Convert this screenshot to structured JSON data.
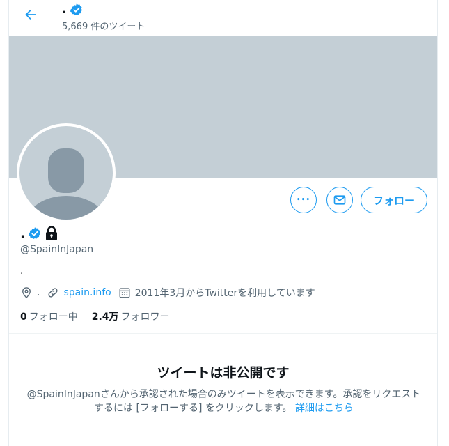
{
  "header": {
    "name": ".",
    "tweet_count": "5,669 件のツイート"
  },
  "profile": {
    "name": ".",
    "handle": "@SpainInJapan",
    "bio": ".",
    "location": ".",
    "website": "spain.info",
    "joined": "2011年3月からTwitterを利用しています",
    "following_count": "0",
    "following_label": "フォロー中",
    "followers_count": "2.4万",
    "followers_label": "フォロワー"
  },
  "actions": {
    "more_label": "•••",
    "follow_label": "フォロー"
  },
  "private_notice": {
    "title": "ツイートは非公開です",
    "description": "@SpainInJapanさんから承認された場合のみツイートを表示できます。承認をリクエストするには [フォローする] をクリックします。",
    "link_label": "詳細はこちら"
  },
  "colors": {
    "accent": "#1d9bf0",
    "banner": "#c4cfd6",
    "avatar_silhouette": "#8899a6",
    "secondary_text": "#536471"
  },
  "icons": {
    "back": "arrow-left-icon",
    "verified": "verified-badge-icon",
    "protected": "lock-icon",
    "location": "location-pin-icon",
    "link": "link-icon",
    "calendar": "calendar-icon",
    "mail": "mail-icon"
  }
}
